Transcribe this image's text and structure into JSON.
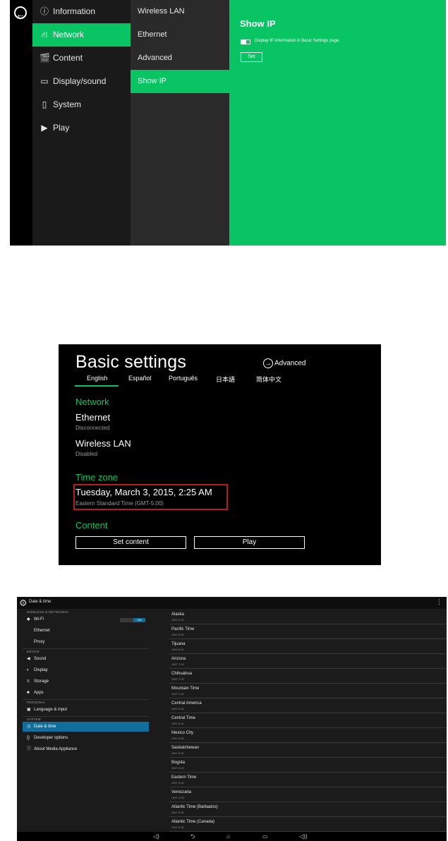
{
  "screen1": {
    "menu": [
      {
        "icon": "ⓘ",
        "icon_name": "info-icon",
        "label": "Information"
      },
      {
        "icon": "⛙",
        "icon_name": "network-icon",
        "label": "Network"
      },
      {
        "icon": "🎬",
        "icon_name": "content-icon",
        "label": "Content"
      },
      {
        "icon": "▭",
        "icon_name": "display-icon",
        "label": "Display/sound"
      },
      {
        "icon": "▯",
        "icon_name": "system-icon",
        "label": "System"
      },
      {
        "icon": "▶",
        "icon_name": "play-icon",
        "label": "Play"
      }
    ],
    "submenu": [
      "Wireless LAN",
      "Ethernet",
      "Advanced",
      "Show IP"
    ],
    "panel_title": "Show IP",
    "toggle_label": "Display IP information in Basic Settings page.",
    "set_button": "Set",
    "accent_color": "#08c463"
  },
  "screen2": {
    "title": "Basic settings",
    "advanced": "Advanced",
    "languages": [
      "English",
      "Español",
      "Português",
      "日本語",
      "简体中文"
    ],
    "network_header": "Network",
    "ethernet": "Ethernet",
    "ethernet_status": "Disconnected",
    "wireless": "Wireless LAN",
    "wireless_status": "Disabled",
    "timezone_header": "Time zone",
    "datetime": "Tuesday, March 3, 2015, 2:25 AM",
    "timezone": "Eastern Standard Time (GMT-5:00)",
    "content_header": "Content",
    "set_content": "Set content",
    "play": "Play"
  },
  "screen3": {
    "title": "Date & time",
    "headers": {
      "wireless": "WIRELESS & NETWORKS",
      "device": "DEVICE",
      "personal": "PERSONAL",
      "system": "SYSTEM"
    },
    "wifi": "Wi-Fi",
    "wifi_toggle": "ON",
    "ethernet": "Ethernet",
    "proxy": "Proxy",
    "sound": "Sound",
    "display": "Display",
    "storage": "Storage",
    "apps": "Apps",
    "language": "Language & input",
    "datetime": "Date & time",
    "developer": "Developer options",
    "about": "About Media Appliance",
    "timezones": [
      {
        "name": "Alaska",
        "gmt": "GMT-9:00"
      },
      {
        "name": "Pacific Time",
        "gmt": "GMT-8:00"
      },
      {
        "name": "Tijuana",
        "gmt": "GMT-8:00"
      },
      {
        "name": "Arizona",
        "gmt": "GMT-7:00"
      },
      {
        "name": "Chihuahua",
        "gmt": "GMT-7:00"
      },
      {
        "name": "Mountain Time",
        "gmt": "GMT-7:00"
      },
      {
        "name": "Central America",
        "gmt": "GMT-6:00"
      },
      {
        "name": "Central Time",
        "gmt": "GMT-6:00"
      },
      {
        "name": "Mexico City",
        "gmt": "GMT-6:00"
      },
      {
        "name": "Saskatchewan",
        "gmt": "GMT-6:00"
      },
      {
        "name": "Bogota",
        "gmt": "GMT-5:00"
      },
      {
        "name": "Eastern Time",
        "gmt": "GMT-5:00"
      },
      {
        "name": "Venezuela",
        "gmt": "GMT-4:30"
      },
      {
        "name": "Atlantic Time (Barbados)",
        "gmt": "GMT-4:00"
      },
      {
        "name": "Atlantic Time (Canada)",
        "gmt": "GMT-4:00"
      }
    ],
    "accent_color": "#0f6e9c"
  }
}
